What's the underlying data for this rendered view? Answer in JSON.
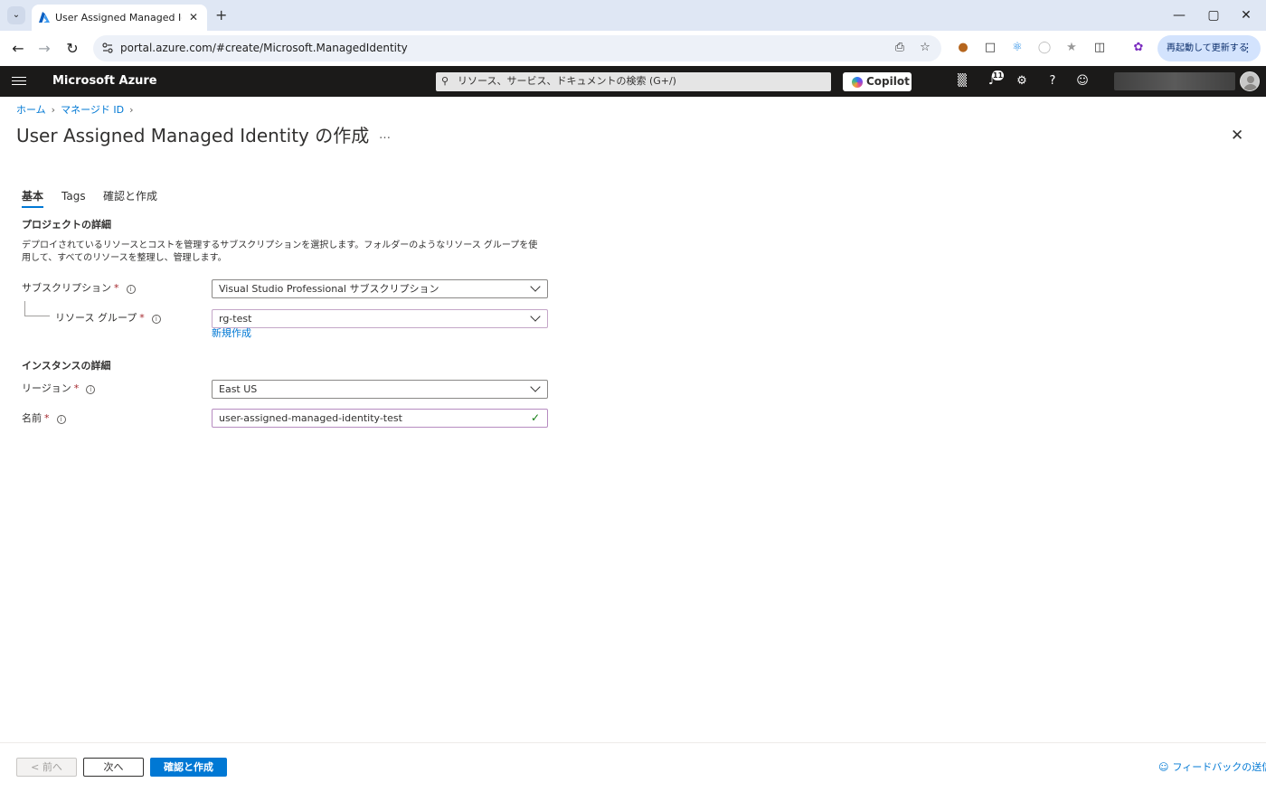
{
  "browser": {
    "tab_title": "User Assigned Managed Identit",
    "url": "portal.azure.com/#create/Microsoft.ManagedIdentity",
    "relaunch_label": "再起動して更新する"
  },
  "azure": {
    "brand": "Microsoft Azure",
    "search_placeholder": "リソース、サービス、ドキュメントの検索 (G+/)",
    "copilot_label": "Copilot",
    "notification_count": "11"
  },
  "breadcrumb": [
    {
      "label": "ホーム"
    },
    {
      "label": "マネージド ID"
    }
  ],
  "page": {
    "title": "User Assigned Managed Identity の作成",
    "more": "…"
  },
  "tabs": [
    {
      "label": "基本",
      "active": true
    },
    {
      "label": "Tags",
      "active": false
    },
    {
      "label": "確認と作成",
      "active": false
    }
  ],
  "project": {
    "heading": "プロジェクトの詳細",
    "description": "デプロイされているリソースとコストを管理するサブスクリプションを選択します。フォルダーのようなリソース グループを使用して、すべてのリソースを整理し、管理します。",
    "subscription_label": "サブスクリプション",
    "subscription_value": "Visual Studio Professional サブスクリプション",
    "resource_group_label": "リソース グループ",
    "resource_group_value": "rg-test",
    "create_new_link": "新規作成"
  },
  "instance": {
    "heading": "インスタンスの詳細",
    "region_label": "リージョン",
    "region_value": "East US",
    "name_label": "名前",
    "name_value": "user-assigned-managed-identity-test"
  },
  "required_marker": "*",
  "footer": {
    "prev_label": "< 前へ",
    "next_label": "次へ",
    "create_label": "確認と作成",
    "feedback_label": "フィードバックの送信"
  },
  "colors": {
    "azure_blue": "#0078d4",
    "topbar": "#1b1a19",
    "required": "#a4262c",
    "valid": "#107c10"
  }
}
